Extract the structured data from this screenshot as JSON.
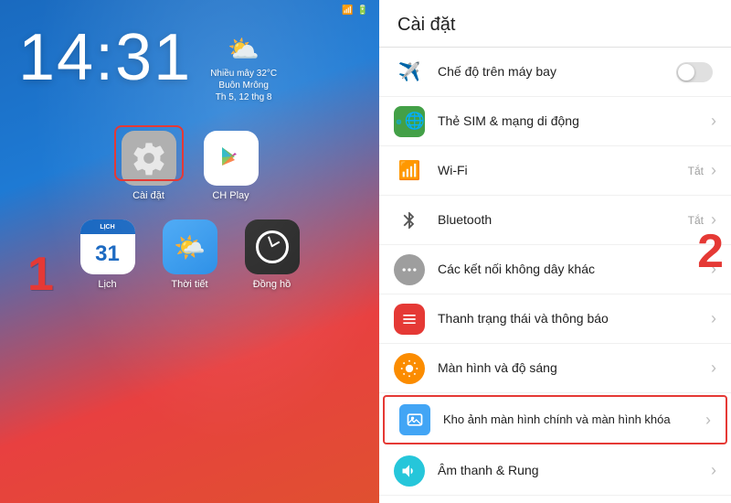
{
  "left": {
    "time": "14:31",
    "weather": {
      "icon": "⛅",
      "description": "Nhiều mây 32°C\nBuôn Mrông\nTh 5, 12 thg 8"
    },
    "step1": "1",
    "apps_top": [
      {
        "id": "settings",
        "label": "Cài đặt",
        "highlighted": true
      },
      {
        "id": "chplay",
        "label": "CH Play",
        "highlighted": false
      }
    ],
    "apps_bottom": [
      {
        "id": "calendar",
        "label": "Lịch",
        "date": "31"
      },
      {
        "id": "weather",
        "label": "Thời tiết"
      },
      {
        "id": "clock",
        "label": "Đồng hồ"
      }
    ]
  },
  "right": {
    "title": "Cài đặt",
    "step2": "2",
    "items": [
      {
        "id": "airplane",
        "icon_type": "airplane",
        "label": "Chế độ trên máy bay",
        "toggle": true,
        "status": ""
      },
      {
        "id": "sim",
        "icon_type": "sim",
        "label": "Thẻ SIM & mạng di động",
        "chevron": true,
        "status": ""
      },
      {
        "id": "wifi",
        "icon_type": "wifi",
        "label": "Wi-Fi",
        "chevron": true,
        "status": "Tắt"
      },
      {
        "id": "bluetooth",
        "icon_type": "bluetooth",
        "label": "Bluetooth",
        "chevron": true,
        "status": "Tắt"
      },
      {
        "id": "connections",
        "icon_type": "connections",
        "label": "Các kết nối không dây khác",
        "chevron": true,
        "status": ""
      },
      {
        "id": "notification",
        "icon_type": "notification",
        "label": "Thanh trạng thái và thông báo",
        "chevron": true,
        "status": ""
      },
      {
        "id": "display",
        "icon_type": "display",
        "label": "Màn hình và độ sáng",
        "chevron": true,
        "status": ""
      },
      {
        "id": "wallpaper",
        "icon_type": "wallpaper",
        "label": "Kho ảnh màn hình chính và màn hình khóa",
        "chevron": true,
        "status": "",
        "highlighted": true
      },
      {
        "id": "sound",
        "icon_type": "sound",
        "label": "Âm thanh & Rung",
        "chevron": true,
        "status": ""
      }
    ]
  }
}
